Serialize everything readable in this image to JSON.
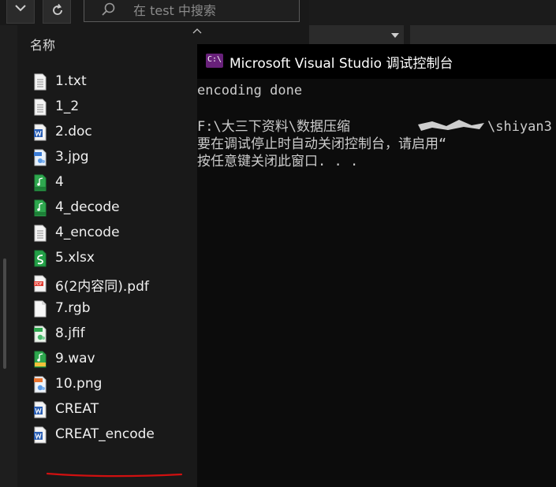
{
  "explorer": {
    "search_placeholder": "在 test 中搜索",
    "column_header": "名称",
    "files": [
      {
        "name": "1.txt",
        "icon": "text-file-icon"
      },
      {
        "name": "1_2",
        "icon": "text-file-icon"
      },
      {
        "name": "2.doc",
        "icon": "word-doc-icon"
      },
      {
        "name": "3.jpg",
        "icon": "jpg-image-icon"
      },
      {
        "name": "4",
        "icon": "mp3-audio-icon"
      },
      {
        "name": "4_decode",
        "icon": "mp3-audio-icon"
      },
      {
        "name": "4_encode",
        "icon": "text-file-icon"
      },
      {
        "name": "5.xlsx",
        "icon": "spreadsheet-icon"
      },
      {
        "name": "6(2内容同).pdf",
        "icon": "pdf-icon"
      },
      {
        "name": "7.rgb",
        "icon": "blank-file-icon"
      },
      {
        "name": "8.jfif",
        "icon": "jfif-image-icon"
      },
      {
        "name": "9.wav",
        "icon": "wav-audio-icon"
      },
      {
        "name": "10.png",
        "icon": "png-image-icon"
      },
      {
        "name": "CREAT",
        "icon": "word-doc-icon"
      },
      {
        "name": "CREAT_encode",
        "icon": "word-doc-icon"
      }
    ],
    "annotation_color": "#d01010"
  },
  "console": {
    "title": "Microsoft Visual Studio 调试控制台",
    "lines": [
      "encoding done",
      "",
      "F:\\大三下资料\\数据压缩",
      "要在调试停止时自动关闭控制台，请启用“",
      "按任意键关闭此窗口. . ."
    ],
    "line3_tail": "\\shiyan3"
  }
}
